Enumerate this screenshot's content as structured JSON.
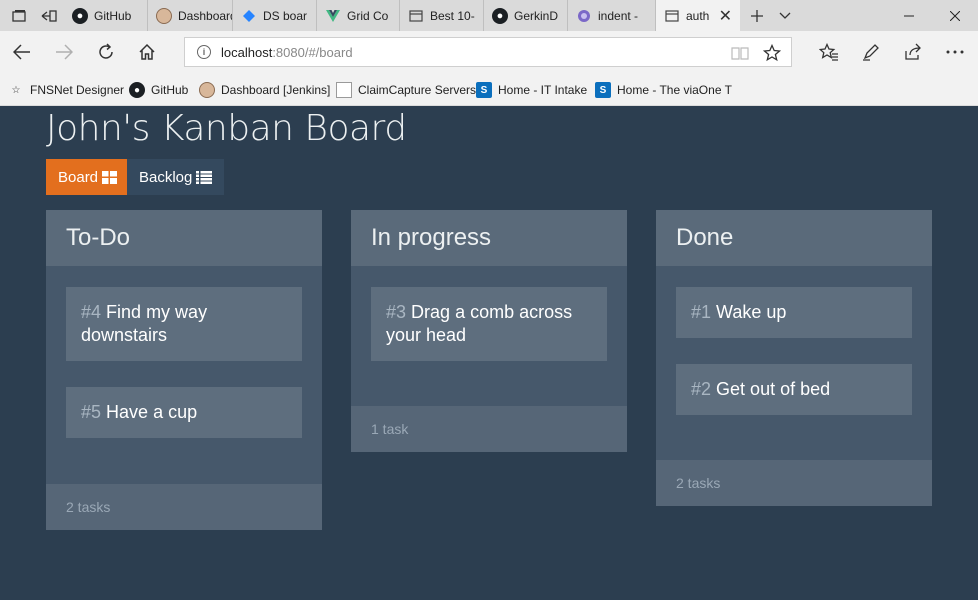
{
  "browser": {
    "tabs": [
      {
        "title": "GitHub",
        "icon": "github-icon"
      },
      {
        "title": "Dashboard",
        "icon": "jenkins-icon"
      },
      {
        "title": "DS boar",
        "icon": "jira-icon"
      },
      {
        "title": "Grid Co",
        "icon": "vue-icon"
      },
      {
        "title": "Best 10-",
        "icon": "page-icon"
      },
      {
        "title": "GerkinD",
        "icon": "github-icon"
      },
      {
        "title": "indent -",
        "icon": "globe-icon"
      },
      {
        "title": "auth",
        "icon": "page-icon"
      }
    ],
    "address": {
      "host": "localhost",
      "rest": ":8080/#/board"
    },
    "favorites": [
      {
        "label": "FNSNet Designer",
        "icon": "star-icon"
      },
      {
        "label": "GitHub",
        "icon": "github-icon"
      },
      {
        "label": "Dashboard [Jenkins]",
        "icon": "jenkins-icon"
      },
      {
        "label": "ClaimCapture Servers",
        "icon": "document-icon"
      },
      {
        "label": "Home - IT Intake",
        "icon": "sharepoint-icon"
      },
      {
        "label": "Home - The viaOne T",
        "icon": "sharepoint-icon"
      }
    ]
  },
  "app": {
    "title": "John's Kanban Board",
    "tabs": [
      {
        "label": "Board",
        "icon": "grid-icon",
        "active": true
      },
      {
        "label": "Backlog",
        "icon": "list-icon",
        "active": false
      }
    ],
    "columns": [
      {
        "title": "To-Do",
        "cards": [
          {
            "id": "#4",
            "text": "Find my way downstairs"
          },
          {
            "id": "#5",
            "text": "Have a cup"
          }
        ],
        "footer": "2 tasks"
      },
      {
        "title": "In progress",
        "cards": [
          {
            "id": "#3",
            "text": "Drag a comb across your head"
          }
        ],
        "footer": "1 task"
      },
      {
        "title": "Done",
        "cards": [
          {
            "id": "#1",
            "text": "Wake up"
          },
          {
            "id": "#2",
            "text": "Get out of bed"
          }
        ],
        "footer": "2 tasks"
      }
    ]
  },
  "colors": {
    "background": "#2c3e50",
    "accent": "#e36f1e",
    "column": "#46586b",
    "card": "#5e6e7e"
  }
}
